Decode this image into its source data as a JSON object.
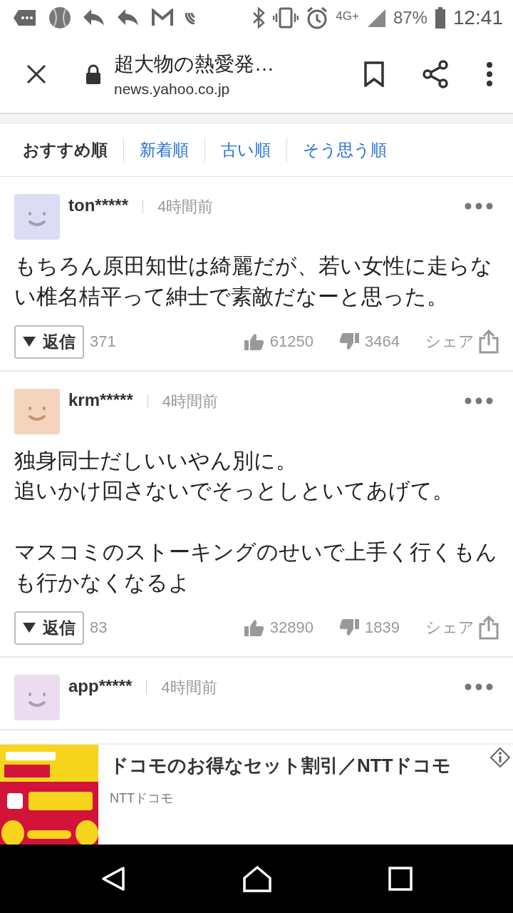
{
  "status_bar": {
    "network": "4G+",
    "battery": "87%",
    "time": "12:41"
  },
  "browser_bar": {
    "title": "超大物の熱愛発…",
    "url": "news.yahoo.co.jp"
  },
  "sort_tabs": [
    {
      "label": "おすすめ順",
      "selected": true
    },
    {
      "label": "新着順",
      "selected": false
    },
    {
      "label": "古い順",
      "selected": false
    },
    {
      "label": "そう思う順",
      "selected": false
    }
  ],
  "comments": [
    {
      "user": "ton*****",
      "time": "4時間前",
      "color": "#dcdcf4",
      "paragraphs": [
        [
          "もちろん原田知世は綺麗だが、若い女性に走らない椎名桔平って紳士で素敵だなーと思った。"
        ]
      ],
      "reply_label": "返信",
      "replies": "371",
      "likes": "61250",
      "dislikes": "3464",
      "share": "シェア"
    },
    {
      "user": "krm*****",
      "time": "4時間前",
      "color": "#f4d4bc",
      "paragraphs": [
        [
          "独身同士だしいいやん別に。",
          "追いかけ回さないでそっとしといてあげて。"
        ],
        [
          "マスコミのストーキングのせいで上手く行くもんも行かなくなるよ"
        ]
      ],
      "reply_label": "返信",
      "replies": "83",
      "likes": "32890",
      "dislikes": "1839",
      "share": "シェア"
    },
    {
      "user": "app*****",
      "time": "4時間前",
      "color": "#ecdcf0"
    }
  ],
  "ad": {
    "title": "ドコモのお得なセット割引／NTTドコモ",
    "sponsor": "NTTドコモ"
  }
}
